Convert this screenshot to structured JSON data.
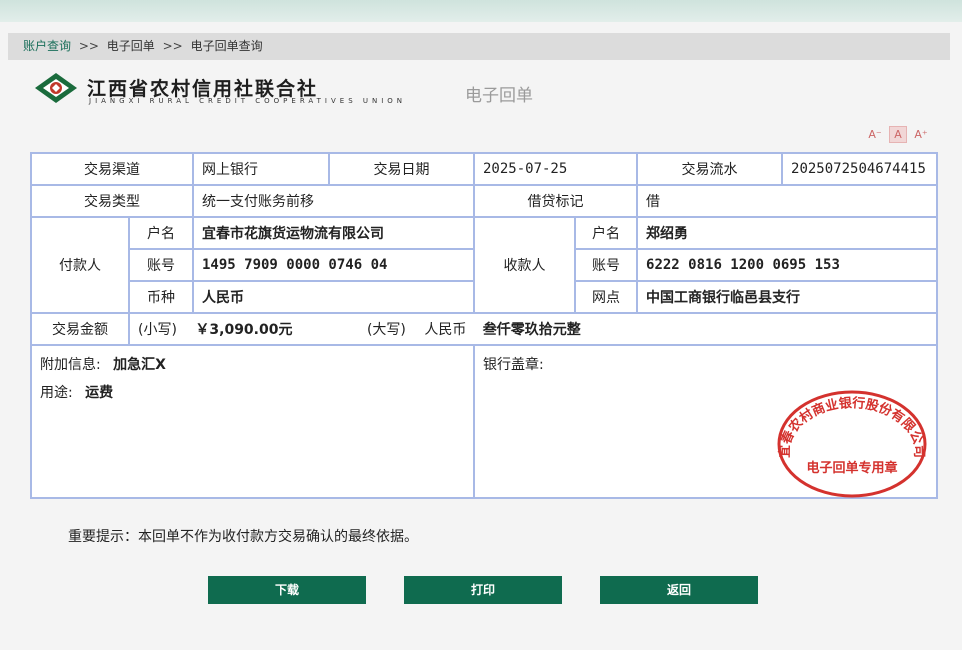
{
  "breadcrumb": {
    "root": "账户查询",
    "sep": ">>",
    "level2": "电子回单",
    "level3": "电子回单查询"
  },
  "logo": {
    "cn": "江西省农村信用社联合社",
    "en": "JIANGXI RURAL CREDIT COOPERATIVES UNION"
  },
  "doc_title": "电子回单",
  "font_controls": {
    "smaller": "A⁻",
    "normal": "A",
    "larger": "A⁺"
  },
  "receipt": {
    "channel_label": "交易渠道",
    "channel": "网上银行",
    "date_label": "交易日期",
    "date": "2025-07-25",
    "serial_label": "交易流水",
    "serial": "2025072504674415",
    "type_label": "交易类型",
    "type": "统一支付账务前移",
    "dc_label": "借贷标记",
    "dc": "借",
    "payer_label": "付款人",
    "payer": {
      "name_label": "户名",
      "name": "宜春市花旗货运物流有限公司",
      "acct_label": "账号",
      "acct": "1495 7909 0000 0746 04",
      "currency_label": "币种",
      "currency": "人民币"
    },
    "payee_label": "收款人",
    "payee": {
      "name_label": "户名",
      "name": "郑绍勇",
      "acct_label": "账号",
      "acct": "6222 0816 1200 0695 153",
      "branch_label": "网点",
      "branch": "中国工商银行临邑县支行"
    },
    "amount_label": "交易金额",
    "amount_small_label": "(小写)",
    "amount_small": "￥3,090.00元",
    "amount_big_label": "(大写)",
    "amount_big_prefix": "人民币",
    "amount_big": "叁仟零玖拾元整",
    "extra_label": "附加信息:",
    "extra": "加急汇X",
    "purpose_label": "用途:",
    "purpose": "运费",
    "seal_label": "银行盖章:"
  },
  "stamp": {
    "ring_text": "宜春农村商业银行股份有限公司",
    "center_text": "电子回单专用章",
    "color": "#d4322e"
  },
  "notice": "重要提示：本回单不作为收付款方交易确认的最终依据。",
  "buttons": {
    "download": "下载",
    "print": "打印",
    "back": "返回"
  }
}
